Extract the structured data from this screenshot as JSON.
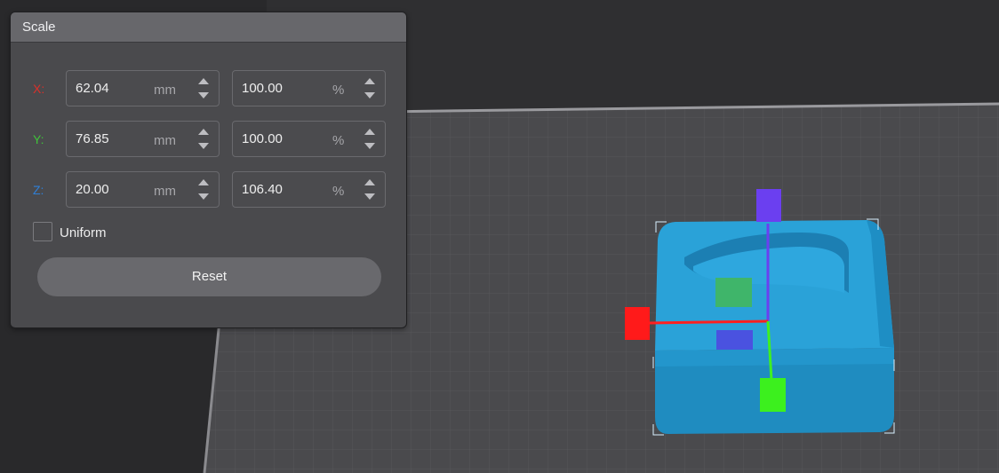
{
  "panel": {
    "title": "Scale",
    "rows": [
      {
        "axis": "X:",
        "axis_color": "#d9302a",
        "size": "62.04",
        "size_unit": "mm",
        "percent": "100.00",
        "percent_unit": "%"
      },
      {
        "axis": "Y:",
        "axis_color": "#3fc23a",
        "size": "76.85",
        "size_unit": "mm",
        "percent": "100.00",
        "percent_unit": "%"
      },
      {
        "axis": "Z:",
        "axis_color": "#2f7fd6",
        "size": "20.00",
        "size_unit": "mm",
        "percent": "106.40",
        "percent_unit": "%"
      }
    ],
    "uniform_label": "Uniform",
    "uniform_checked": false,
    "reset_label": "Reset"
  },
  "viewport": {
    "model_color": "#2aa0d6",
    "handle_colors": {
      "x": "#ff1a1a",
      "y": "#3cf01e",
      "z": "#6b3ff0"
    }
  }
}
